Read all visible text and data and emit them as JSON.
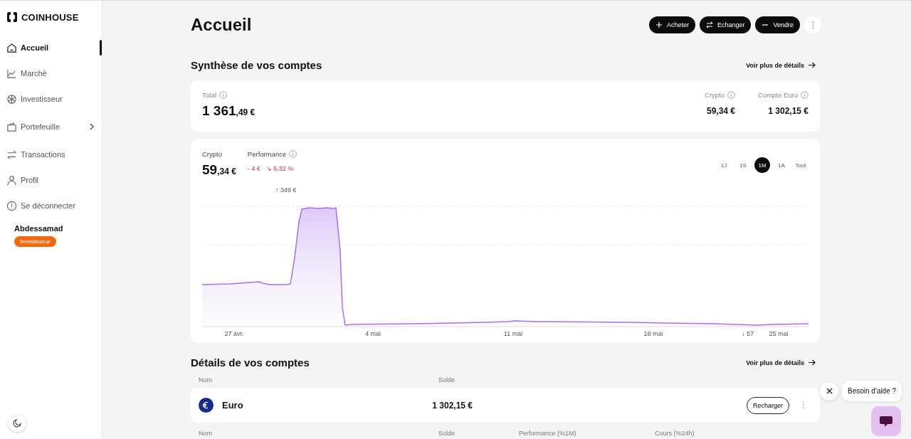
{
  "brand": {
    "name": "COINHOUSE"
  },
  "sidebar": {
    "items": [
      {
        "label": "Accueil",
        "selected": true,
        "has_submenu": false
      },
      {
        "label": "Marché",
        "selected": false,
        "has_submenu": false
      },
      {
        "label": "Investisseur",
        "selected": false,
        "has_submenu": false
      },
      {
        "label": "Portefeuille",
        "selected": false,
        "has_submenu": true
      },
      {
        "label": "Transactions",
        "selected": false,
        "has_submenu": false
      },
      {
        "label": "Profil",
        "selected": false,
        "has_submenu": false
      },
      {
        "label": "Se déconnecter",
        "selected": false,
        "has_submenu": false
      }
    ],
    "user": {
      "name": "Abdessamad",
      "badge": "Investisseur"
    }
  },
  "page": {
    "title": "Accueil",
    "actions": [
      {
        "label": "Acheter"
      },
      {
        "label": "Echanger"
      },
      {
        "label": "Vendre"
      }
    ]
  },
  "summary": {
    "title": "Synthèse de vos comptes",
    "link": "Voir plus de détails",
    "total": {
      "label": "Total",
      "int": "1 361",
      "dec": ",49 €"
    },
    "parts": [
      {
        "label": "Crypto",
        "value": "59,34 €"
      },
      {
        "label": "Compte Euro",
        "value": "1 302,15 €"
      }
    ]
  },
  "crypto": {
    "label": "Crypto",
    "int": "59",
    "dec": ",34 €",
    "perf_label": "Performance",
    "perf_abs": "- 4 €",
    "perf_pct": "↘ 6,32 %",
    "periods": [
      {
        "label": "1J",
        "selected": false
      },
      {
        "label": "1S",
        "selected": false
      },
      {
        "label": "1M",
        "selected": true
      },
      {
        "label": "1A",
        "selected": false
      },
      {
        "label": "Tout",
        "selected": false
      }
    ],
    "max_label": "↑ 349 €",
    "min_label": "↓ 57",
    "x_labels": [
      "27 avr.",
      "4 mai",
      "11 mai",
      "18 mai",
      "25 mai"
    ]
  },
  "details": {
    "title": "Détails de vos comptes",
    "link": "Voir plus de détails",
    "columns": [
      "Nom",
      "Solde"
    ],
    "rows": [
      {
        "name": "Euro",
        "balance": "1 302,15 €",
        "action": "Recharger"
      }
    ],
    "columns_2": [
      "Nom",
      "Solde",
      "Performance (%1M)",
      "Cours (%24h)"
    ]
  },
  "help": {
    "label": "Besoin d'aide ?"
  }
}
